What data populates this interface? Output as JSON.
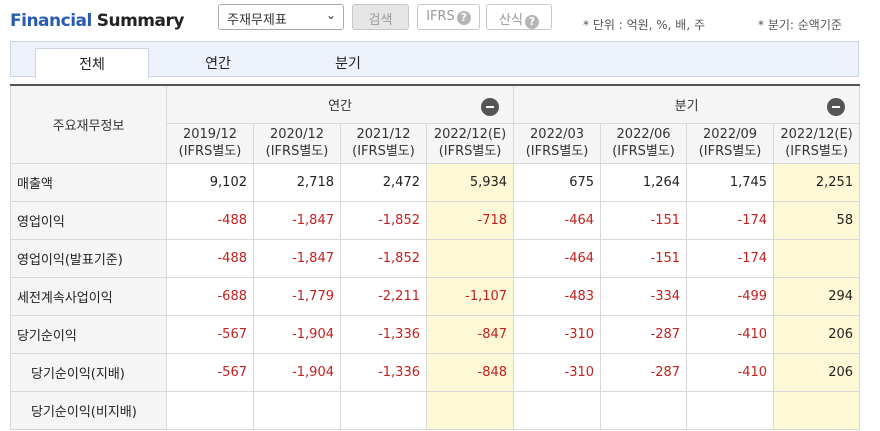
{
  "header": {
    "title_a": "Financial",
    "title_b": "Summary",
    "select_value": "주재무제표",
    "search_label": "검색",
    "ifrs_label": "IFRS",
    "sansik_label": "산식",
    "help_glyph": "?",
    "unit_note": "* 단위 : 억원, %, 배, 주",
    "quarter_note": "* 분기: 순액기준"
  },
  "tabs": [
    "전체",
    "연간",
    "분기"
  ],
  "table": {
    "corner_label": "주요재무정보",
    "group_annual": "연간",
    "group_quarter": "분기",
    "columns": [
      {
        "period": "2019/12",
        "basis": "(IFRS별도)"
      },
      {
        "period": "2020/12",
        "basis": "(IFRS별도)"
      },
      {
        "period": "2021/12",
        "basis": "(IFRS별도)"
      },
      {
        "period": "2022/12(E)",
        "basis": "(IFRS별도)"
      },
      {
        "period": "2022/03",
        "basis": "(IFRS별도)"
      },
      {
        "period": "2022/06",
        "basis": "(IFRS별도)"
      },
      {
        "period": "2022/09",
        "basis": "(IFRS별도)"
      },
      {
        "period": "2022/12(E)",
        "basis": "(IFRS별도)"
      }
    ],
    "rows": [
      {
        "label": "매출액",
        "indent": false,
        "values": [
          "9,102",
          "2,718",
          "2,472",
          "5,934",
          "675",
          "1,264",
          "1,745",
          "2,251"
        ]
      },
      {
        "label": "영업이익",
        "indent": false,
        "values": [
          "-488",
          "-1,847",
          "-1,852",
          "-718",
          "-464",
          "-151",
          "-174",
          "58"
        ]
      },
      {
        "label": "영업이익(발표기준)",
        "indent": false,
        "values": [
          "-488",
          "-1,847",
          "-1,852",
          "",
          "-464",
          "-151",
          "-174",
          ""
        ]
      },
      {
        "label": "세전계속사업이익",
        "indent": false,
        "values": [
          "-688",
          "-1,779",
          "-2,211",
          "-1,107",
          "-483",
          "-334",
          "-499",
          "294"
        ]
      },
      {
        "label": "당기순이익",
        "indent": false,
        "values": [
          "-567",
          "-1,904",
          "-1,336",
          "-847",
          "-310",
          "-287",
          "-410",
          "206"
        ]
      },
      {
        "label": "당기순이익(지배)",
        "indent": true,
        "values": [
          "-567",
          "-1,904",
          "-1,336",
          "-848",
          "-310",
          "-287",
          "-410",
          "206"
        ]
      },
      {
        "label": "당기순이익(비지배)",
        "indent": true,
        "values": [
          "",
          "",
          "",
          "",
          "",
          "",
          "",
          ""
        ]
      }
    ]
  }
}
